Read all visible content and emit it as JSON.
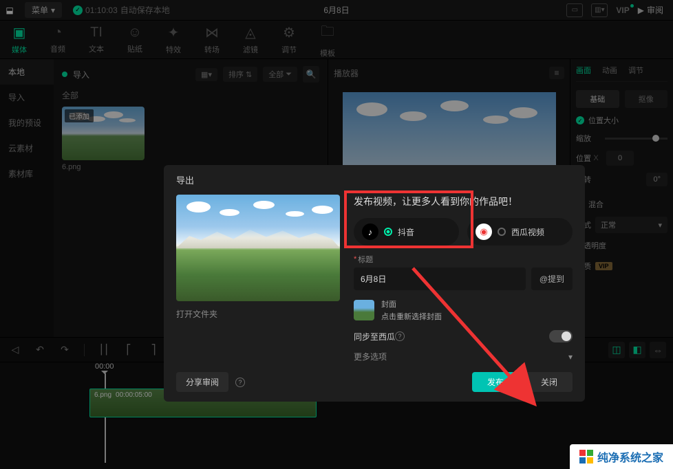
{
  "topbar": {
    "menu": "菜单",
    "autosave_time": "01:10:03",
    "autosave_text": "自动保存本地",
    "title": "6月8日",
    "vip": "VIP",
    "review": "审阅"
  },
  "toolbar": [
    {
      "key": "media",
      "label": "媒体",
      "icon": "▣"
    },
    {
      "key": "audio",
      "label": "音频",
      "icon": "◔"
    },
    {
      "key": "text",
      "label": "文本",
      "icon": "TI"
    },
    {
      "key": "sticker",
      "label": "贴纸",
      "icon": "☺"
    },
    {
      "key": "effect",
      "label": "特效",
      "icon": "✦"
    },
    {
      "key": "transition",
      "label": "转场",
      "icon": "⋈"
    },
    {
      "key": "filter",
      "label": "滤镜",
      "icon": "◬"
    },
    {
      "key": "adjust",
      "label": "调节",
      "icon": "⚙"
    },
    {
      "key": "template",
      "label": "模板",
      "icon": "🗀"
    }
  ],
  "sidebar": [
    "本地",
    "导入",
    "我的预设",
    "云素材",
    "素材库"
  ],
  "media": {
    "import": "导入",
    "sort": "排序",
    "all": "全部",
    "category": "全部",
    "badge": "已添加",
    "filename": "6.png"
  },
  "player": {
    "label": "播放器"
  },
  "props": {
    "tabs": [
      "画面",
      "动画",
      "调节"
    ],
    "subtabs": [
      "基础",
      "抠像"
    ],
    "pos_size": "位置大小",
    "scale": "缩放",
    "pos": "位置",
    "x": "X",
    "x_val": "0",
    "rotate": "旋转",
    "deg": "0°",
    "mix": "混合",
    "mode_label": "模式",
    "mode_val": "正常",
    "opacity": "不透明度",
    "quality": "画质",
    "vip": "VIP"
  },
  "timeline": {
    "playhead": "00:00",
    "clip_name": "6.png",
    "clip_dur": "00:00:05:00"
  },
  "dialog": {
    "title": "导出",
    "open_folder": "打开文件夹",
    "publish_title": "发布视频，让更多人看到你的作品吧！",
    "douyin": "抖音",
    "xigua": "西瓜视频",
    "title_label": "标题",
    "title_value": "6月8日",
    "mention": "@提到",
    "cover": "封面",
    "cover_hint": "点击重新选择封面",
    "sync": "同步至西瓜",
    "more": "更多选项",
    "share": "分享审阅",
    "publish": "发布",
    "close": "关闭"
  },
  "watermark": "纯净系统之家"
}
